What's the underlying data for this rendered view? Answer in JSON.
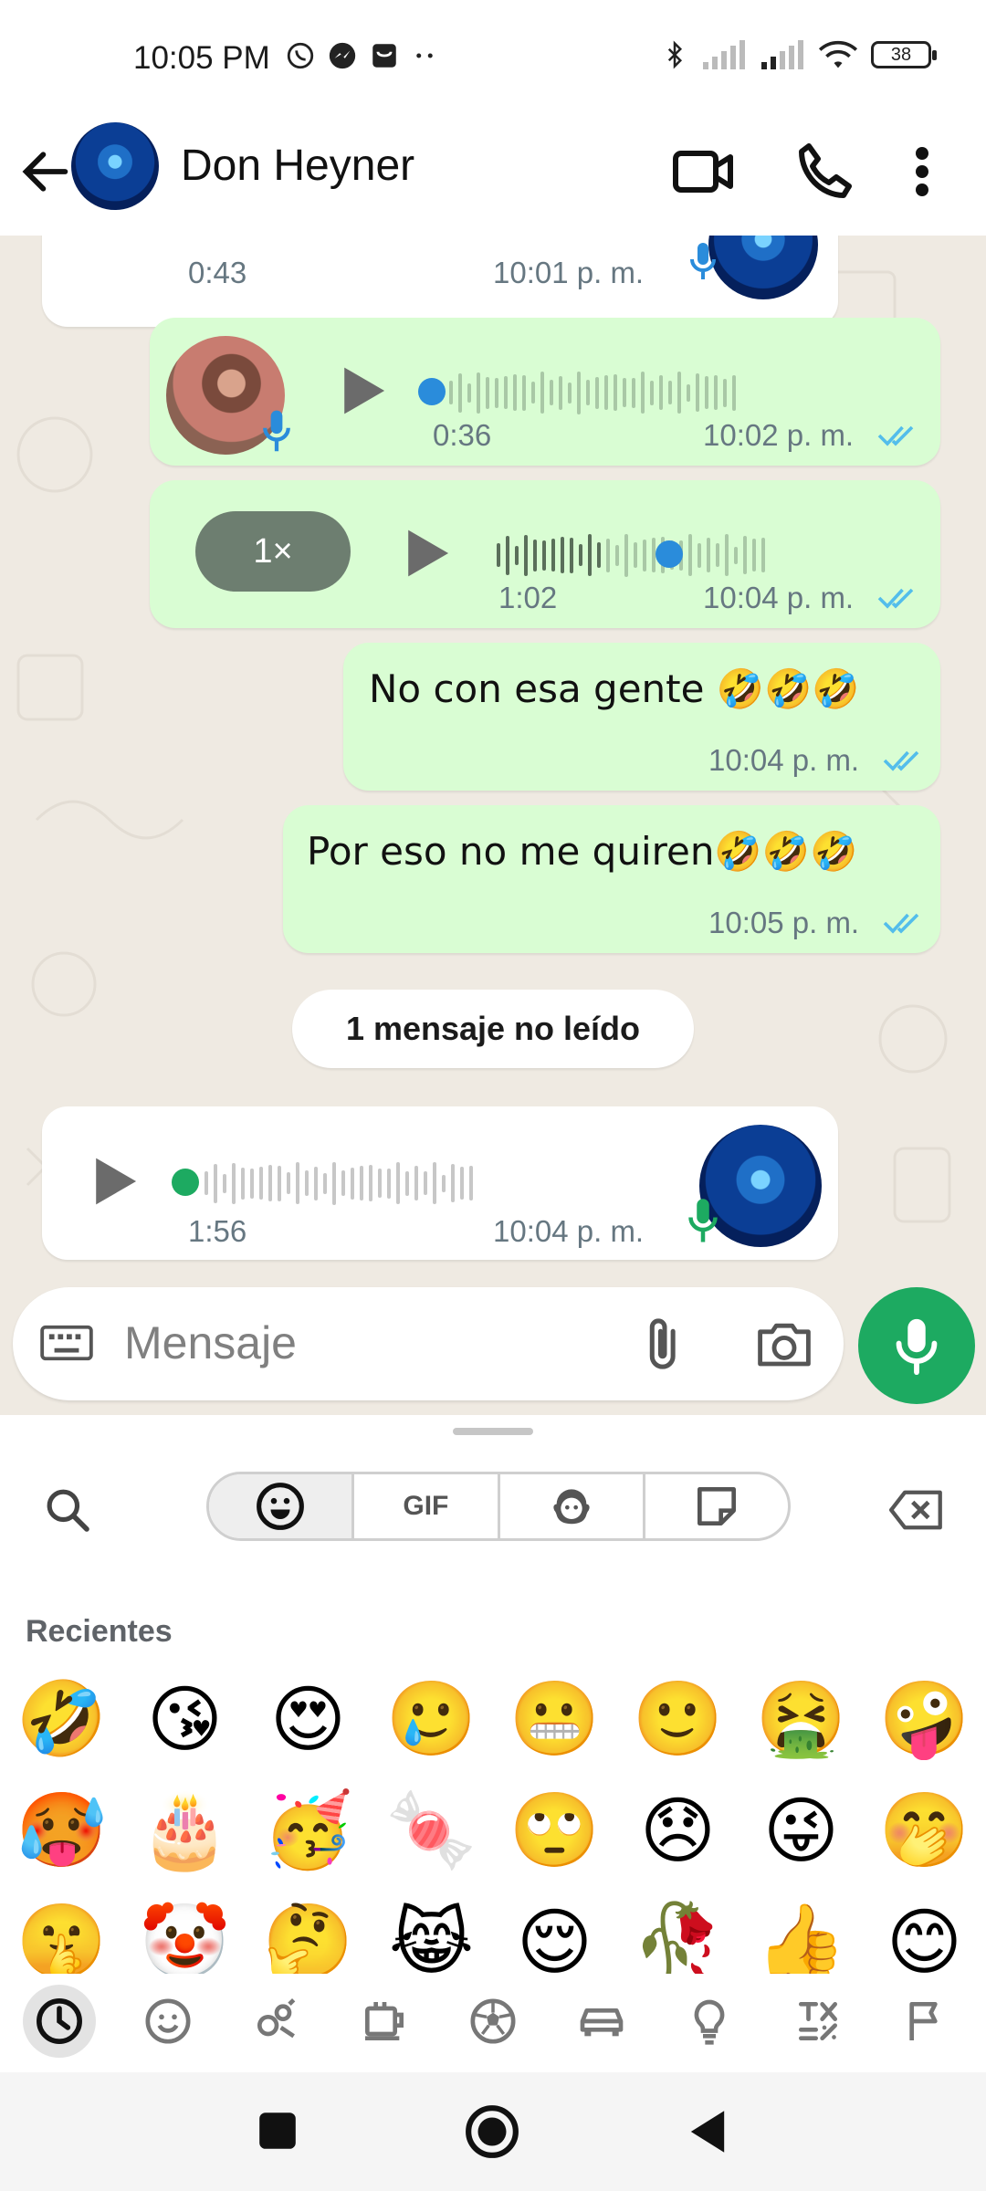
{
  "status": {
    "time": "10:05 PM",
    "battery": "38"
  },
  "header": {
    "contact_name": "Don Heyner"
  },
  "messages": [
    {
      "id": "m0",
      "direction": "in",
      "duration": "0:43",
      "time": "10:01 p. m."
    },
    {
      "id": "m1",
      "direction": "out",
      "duration": "0:36",
      "time": "10:02 p. m."
    },
    {
      "id": "m2",
      "direction": "out",
      "duration": "1:02",
      "time": "10:04 p. m.",
      "speed": "1×"
    },
    {
      "id": "m3",
      "direction": "out",
      "text": "No con esa gente 🤣🤣🤣",
      "time": "10:04 p. m."
    },
    {
      "id": "m4",
      "direction": "out",
      "text": "Por eso no me quiren🤣🤣🤣",
      "time": "10:05 p. m."
    },
    {
      "id": "m5",
      "direction": "in",
      "duration": "1:56",
      "time": "10:04 p. m."
    }
  ],
  "unread_banner": "1 mensaje no leído",
  "composer": {
    "placeholder": "Mensaje"
  },
  "emoji_panel": {
    "tabs": [
      "emoji",
      "GIF",
      "avatar",
      "sticker"
    ],
    "gif_label": "GIF",
    "section_title": "Recientes",
    "recent": [
      "🤣",
      "😘",
      "😍",
      "🥲",
      "😬",
      "🙂",
      "🤮",
      "🤪",
      "🥵",
      "🎂",
      "🥳",
      "🍬",
      "🙄",
      "😞",
      "😜",
      "🤭",
      "🤫",
      "🤡",
      "🤔",
      "😹",
      "😌",
      "🥀",
      "👍",
      "😊"
    ],
    "categories": [
      "recent-icon",
      "smiley-icon",
      "animals-icon",
      "food-icon",
      "sports-icon",
      "car-icon",
      "bulb-icon",
      "symbols-icon",
      "flag-icon"
    ]
  },
  "colors": {
    "accent": "#1daa61",
    "outgoing": "#d9fdd3",
    "read_ticks": "#53bdeb",
    "chat_bg": "#efeae2"
  }
}
